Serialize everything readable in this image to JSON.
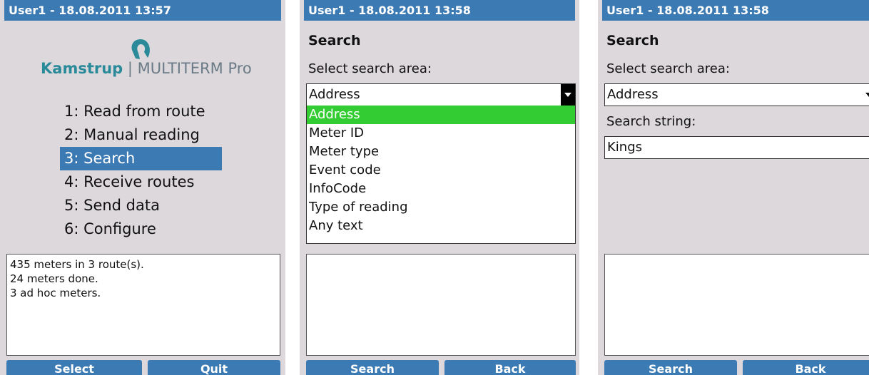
{
  "colors": {
    "screen_bg": "#dcd8dc",
    "titlebar": "#3c7ab4",
    "selection": "#3c7ab4",
    "dropdown_highlight": "#33cc33"
  },
  "screens": [
    {
      "title": "User1 - 18.08.2011 13:57",
      "logo": {
        "icon": "kamstrup-logo-icon",
        "brand": "Kamstrup",
        "separator": " | ",
        "product": "MULTITERM Pro"
      },
      "menu": [
        {
          "label": "1: Read from route",
          "selected": false
        },
        {
          "label": "2: Manual reading",
          "selected": false
        },
        {
          "label": "3: Search",
          "selected": true
        },
        {
          "label": "4: Receive routes",
          "selected": false
        },
        {
          "label": "5: Send data",
          "selected": false
        },
        {
          "label": "6: Configure",
          "selected": false
        }
      ],
      "info_lines": [
        "435 meters in 3 route(s).",
        "24 meters done.",
        "3 ad hoc meters."
      ],
      "buttons": {
        "left": "Select",
        "right": "Quit"
      }
    },
    {
      "title": "User1 - 18.08.2011 13:58",
      "heading": "Search",
      "area_label": "Select search area:",
      "selected_area": "Address",
      "options": [
        "Address",
        "Meter ID",
        "Meter type",
        "Event code",
        "InfoCode",
        "Type of reading",
        "Any text"
      ],
      "highlighted_option": "Address",
      "buttons": {
        "left": "Search",
        "right": "Back"
      }
    },
    {
      "title": "User1 - 18.08.2011 13:58",
      "heading": "Search",
      "area_label": "Select search area:",
      "selected_area": "Address",
      "string_label": "Search string:",
      "search_string": "Kings",
      "buttons": {
        "left": "Search",
        "right": "Back"
      }
    }
  ]
}
